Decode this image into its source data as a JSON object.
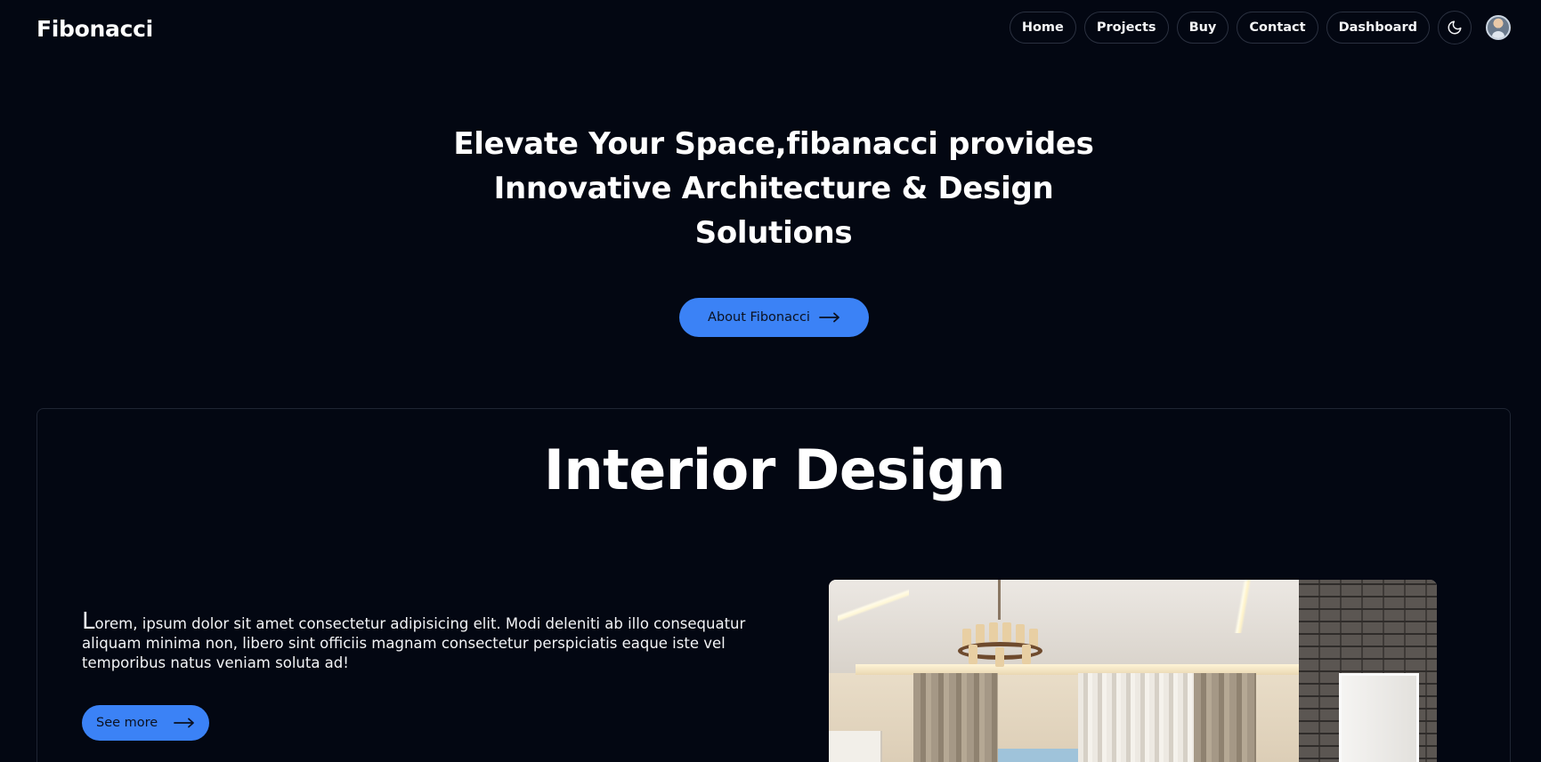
{
  "header": {
    "brand": "Fibonacci",
    "nav_items": [
      "Home",
      "Projects",
      "Buy",
      "Contact",
      "Dashboard"
    ]
  },
  "hero": {
    "title_lines": [
      "Elevate Your Space,fibanacci provides",
      "Innovative Architecture & Design",
      "Solutions"
    ],
    "cta_label": "About Fibonacci"
  },
  "interior": {
    "title": "Interior Design",
    "drop_cap": "L",
    "body": "orem, ipsum dolor sit amet consectetur adipisicing elit. Modi deleniti ab illo consequatur aliquam minima non, libero sint officiis magnam consectetur perspiciatis eaque iste vel temporibus natus veniam soluta ad!",
    "see_more_label": "See more"
  },
  "colors": {
    "background": "#030712",
    "accent": "#3b82f6",
    "pill_border": "#2b3140"
  },
  "icons": {
    "theme_toggle": "moon-icon",
    "cta_arrow": "arrow-right-icon"
  }
}
